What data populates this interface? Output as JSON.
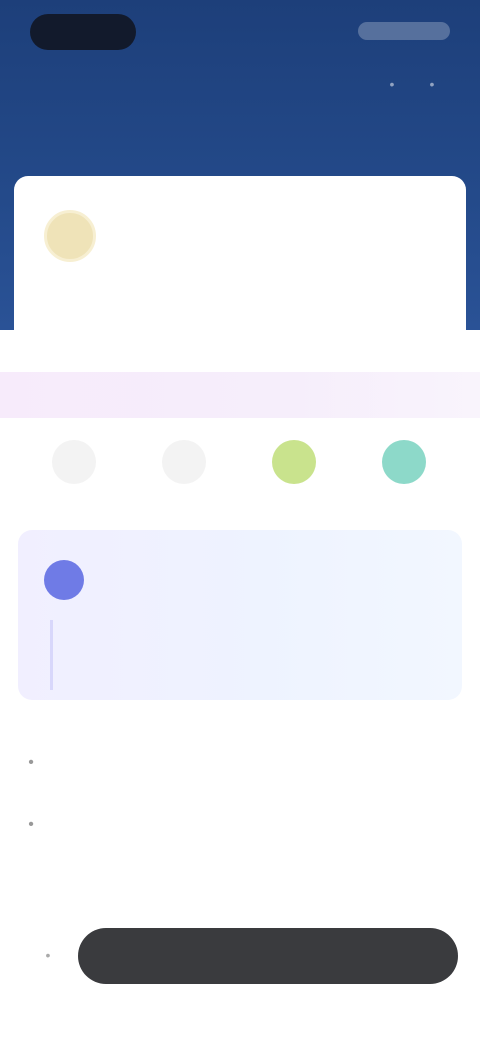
{
  "header": {
    "title": "",
    "icon_left": "more-icon",
    "icon_right": "settings-icon"
  },
  "profile": {
    "name": "",
    "subtitle": ""
  },
  "banner": {
    "text": ""
  },
  "quick_actions": [
    {
      "label": "",
      "icon": "icon-1",
      "color": "#f3f3f3"
    },
    {
      "label": "",
      "icon": "icon-2",
      "color": "#f3f3f3"
    },
    {
      "label": "",
      "icon": "icon-3",
      "color": "#c9e38d"
    },
    {
      "label": "",
      "icon": "icon-4",
      "color": "#8dd9c9"
    }
  ],
  "promo": {
    "title": "",
    "line1": "",
    "line2": "",
    "line3": ""
  },
  "menu": [
    {
      "label": "",
      "icon": "menu-icon"
    },
    {
      "label": "",
      "icon": "info-icon"
    }
  ],
  "bottom_bar": {
    "label": "",
    "left_icon": "home-icon"
  },
  "colors": {
    "header_bg": "#1d3f7a",
    "accent": "#6f7be6",
    "pill_bg": "#3a3b3e"
  }
}
